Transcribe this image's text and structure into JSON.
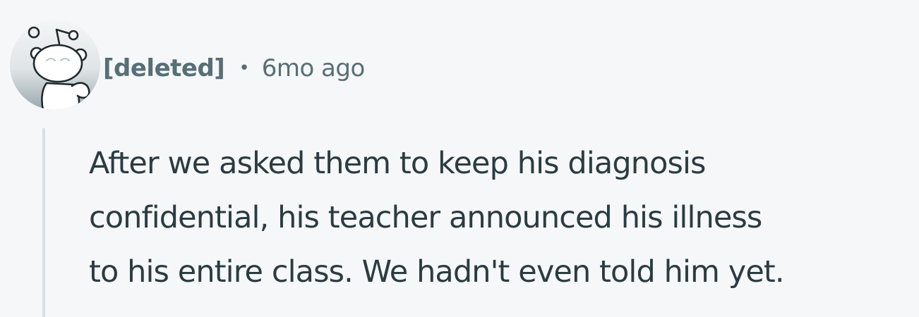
{
  "comment": {
    "author": "[deleted]",
    "separator": "•",
    "timestamp": "6mo ago",
    "avatar_icon": "reddit-snoo-deleted-avatar-icon",
    "body_lines": [
      "After we asked them to keep his diagnosis",
      "confidential, his teacher announced his illness",
      "to his entire class. We hadn't even told him yet."
    ]
  },
  "colors": {
    "background": "#f6f7f8",
    "meta_text": "#576f76",
    "body_text": "#2a3c42",
    "thread_line": "#d8e0e4"
  }
}
